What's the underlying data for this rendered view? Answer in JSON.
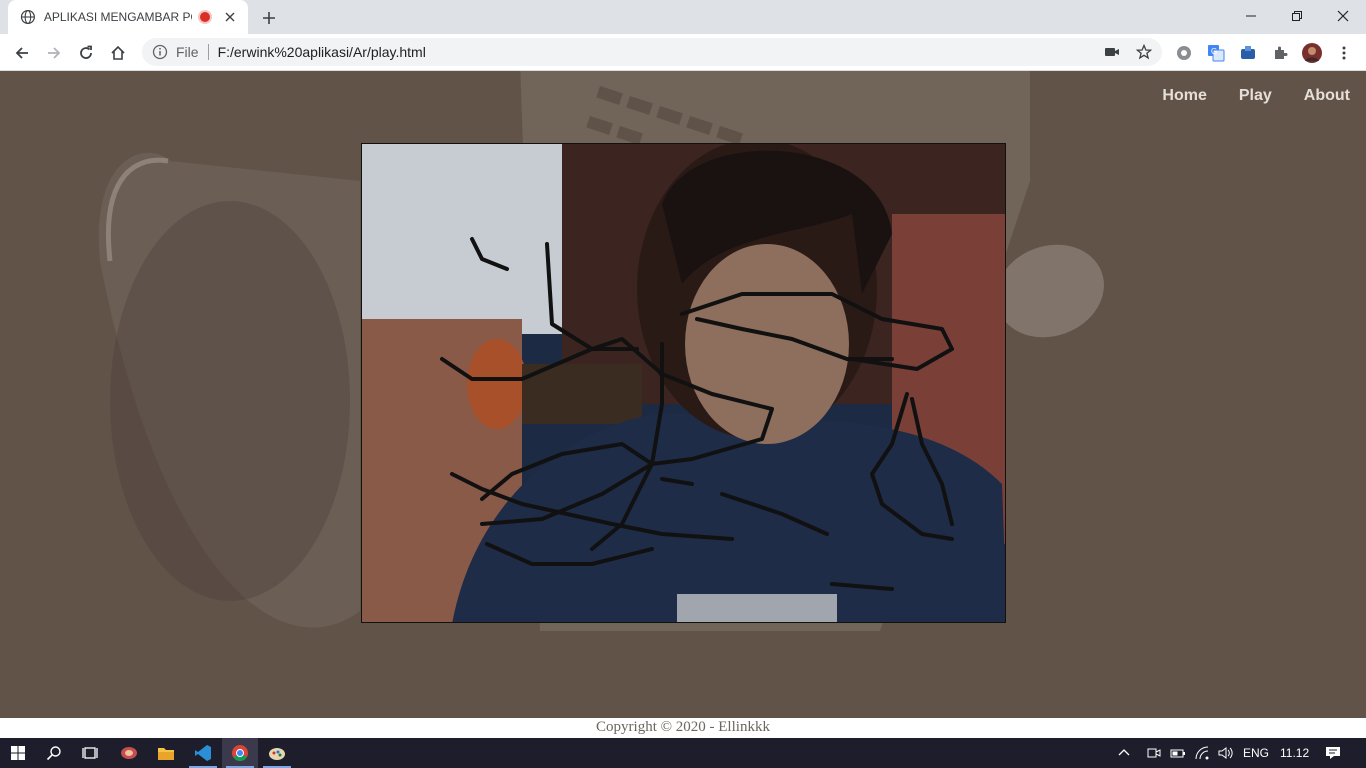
{
  "browser": {
    "tab_title": "APLIKASI MENGAMBAR POLA",
    "address": {
      "security_label": "File",
      "url": "F:/erwink%20aplikasi/Ar/play.html"
    }
  },
  "nav": {
    "items": [
      {
        "label": "Home"
      },
      {
        "label": "Play"
      },
      {
        "label": "About"
      }
    ]
  },
  "footer": {
    "text": "Copyright © 2020 - Ellinkkk"
  },
  "taskbar": {
    "language": "ENG",
    "time": "11.12"
  },
  "colors": {
    "page_bg": "#5e5146",
    "nav_text": "#e6dfd7",
    "stroke": "#111111"
  }
}
